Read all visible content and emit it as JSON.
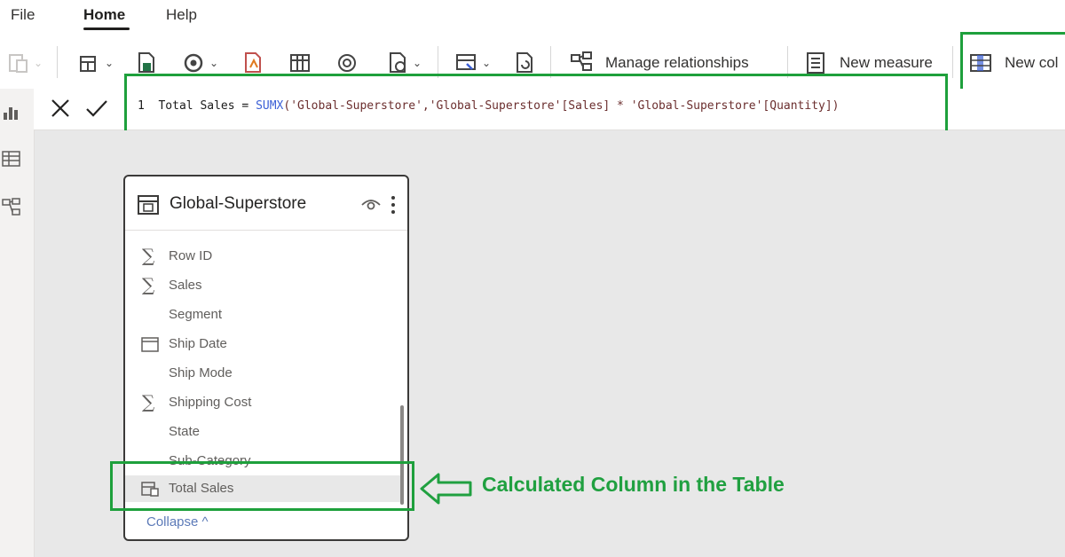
{
  "menu": {
    "tabs": [
      "File",
      "Home",
      "Help"
    ],
    "active": "Home"
  },
  "ribbon": {
    "manage_relationships_label": "Manage relationships",
    "new_measure_label": "New measure",
    "new_column_label": "New col"
  },
  "formula": {
    "line_number": "1",
    "name": "Total Sales",
    "operator": "=",
    "function": "SUMX",
    "args": "('Global-Superstore','Global-Superstore'[Sales] * 'Global-Superstore'[Quantity])"
  },
  "table_card": {
    "title": "Global-Superstore",
    "fields": [
      {
        "name": "Row ID",
        "icon": "sigma-icon"
      },
      {
        "name": "Sales",
        "icon": "sigma-icon"
      },
      {
        "name": "Segment",
        "icon": ""
      },
      {
        "name": "Ship Date",
        "icon": "calendar-icon"
      },
      {
        "name": "Ship Mode",
        "icon": ""
      },
      {
        "name": "Shipping Cost",
        "icon": "sigma-icon"
      },
      {
        "name": "State",
        "icon": ""
      },
      {
        "name": "Sub-Category",
        "icon": ""
      },
      {
        "name": "Total Sales",
        "icon": "calculated-column-icon"
      }
    ],
    "collapse_label": "Collapse ^"
  },
  "annotation": {
    "text": "Calculated Column in the Table"
  },
  "colors": {
    "highlight": "#1ea03c",
    "annotation": "#20a040",
    "function": "#3b5fd6"
  }
}
